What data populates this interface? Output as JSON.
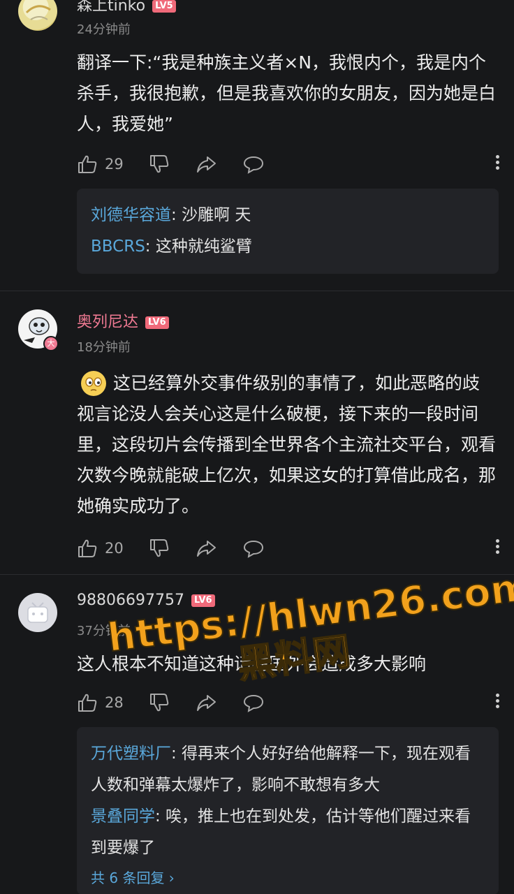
{
  "comments": [
    {
      "username": "森上tinko",
      "level": "LV5",
      "time": "24分钟前",
      "text": "翻译一下:“我是种族主义者×N，我恨内个，我是内个杀手，我很抱歉，但是我喜欢你的女朋友，因为她是白人，我爱她”",
      "likes": "29",
      "replies": [
        {
          "who": "刘德华容道",
          "text": ": 沙雕啊 天"
        },
        {
          "who": "BBCRS",
          "text": ": 这种就纯鲨臂"
        }
      ]
    },
    {
      "username": "奥列尼达",
      "level": "LV6",
      "badge": "大",
      "time": "18分钟前",
      "text": "这已经算外交事件级别的事情了，如此恶略的歧视言论没人会关心这是什么破梗，接下来的一段时间里，这段切片会传播到全世界各个主流社交平台，观看次数今晚就能破上亿次，如果这女的打算借此成名，那她确实成功了。",
      "likes": "20"
    },
    {
      "username": "98806697757",
      "level": "LV6",
      "time": "37分钟前",
      "text": "这人根本不知道这种话在国外会造成多大影响",
      "likes": "28",
      "replies": [
        {
          "who": "万代塑料厂",
          "text": ": 得再来个人好好给他解释一下，现在观看人数和弹幕太爆炸了，影响不敢想有多大"
        },
        {
          "who": "景叠同学",
          "text": ": 唉，推上也在到处发，估计等他们醒过来看到要爆了"
        }
      ],
      "more_replies": "共 6 条回复 ›"
    }
  ],
  "watermark": {
    "url": "https://hlwn26.com",
    "name": "黑料网",
    "color": "#f2a11c"
  },
  "colors": {
    "background": "#17181a",
    "reply_name": "#5aa8db",
    "vip_name": "#f07a93"
  }
}
